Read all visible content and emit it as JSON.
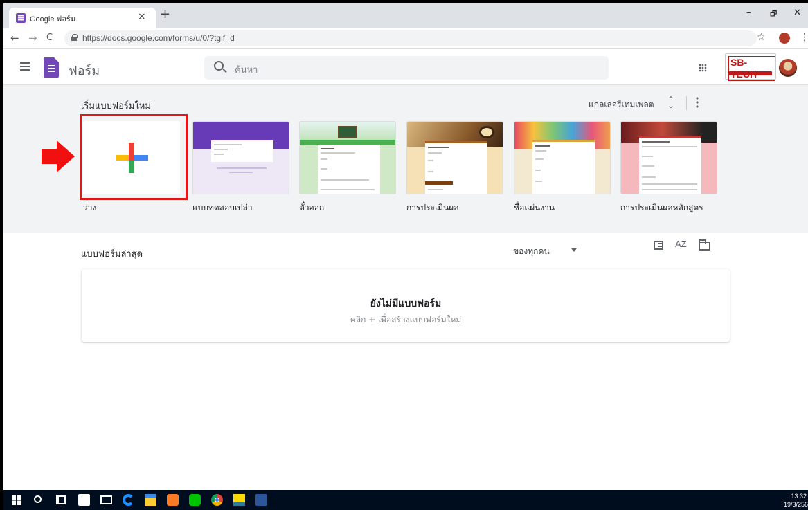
{
  "browser": {
    "tab_title": "Google ฟอร์ม",
    "tab_close": "×",
    "new_tab": "+",
    "url": "https://docs.google.com/forms/u/0/?tgif=d",
    "win_min": "–",
    "win_restore": "🗗",
    "win_close": "✕",
    "back": "←",
    "forward": "→",
    "reload": "C",
    "star": "☆",
    "menu": "⋮"
  },
  "header": {
    "app_title": "ฟอร์ม",
    "search_placeholder": "ค้นหา",
    "brand_text": "SB-TECH"
  },
  "gallery": {
    "title": "เริ่มแบบฟอร์มใหม่",
    "toggle_label": "แกลเลอรีเทมเพลต",
    "expand_glyph": "⌃⌄",
    "templates": [
      {
        "label": "ว่าง"
      },
      {
        "label": "แบบทดสอบเปล่า"
      },
      {
        "label": "ตั๋วออก"
      },
      {
        "label": "การประเมินผล"
      },
      {
        "label": "ชื่อแผ่นงาน"
      },
      {
        "label": "การประเมินผลหลักสูตร"
      }
    ]
  },
  "recent": {
    "title": "แบบฟอร์มล่าสุด",
    "owner_filter": "ของทุกคน",
    "sort_label": "AZ",
    "empty_title": "ยังไม่มีแบบฟอร์ม",
    "empty_hint": "คลิก + เพื่อสร้างแบบฟอร์มใหม่"
  },
  "taskbar": {
    "time": "13:32",
    "date": "19/3/256",
    "icons": [
      "windows-start-icon",
      "search-icon",
      "task-view-icon",
      "store-icon",
      "mail-icon",
      "edge-icon",
      "file-explorer-icon",
      "xampp-icon",
      "line-icon",
      "chrome-icon",
      "sticky-notes-icon",
      "word-icon"
    ]
  },
  "colors": {
    "forms_purple": "#7248b9",
    "highlight_red": "#e01818",
    "gallery_bg": "#f1f3f4"
  }
}
